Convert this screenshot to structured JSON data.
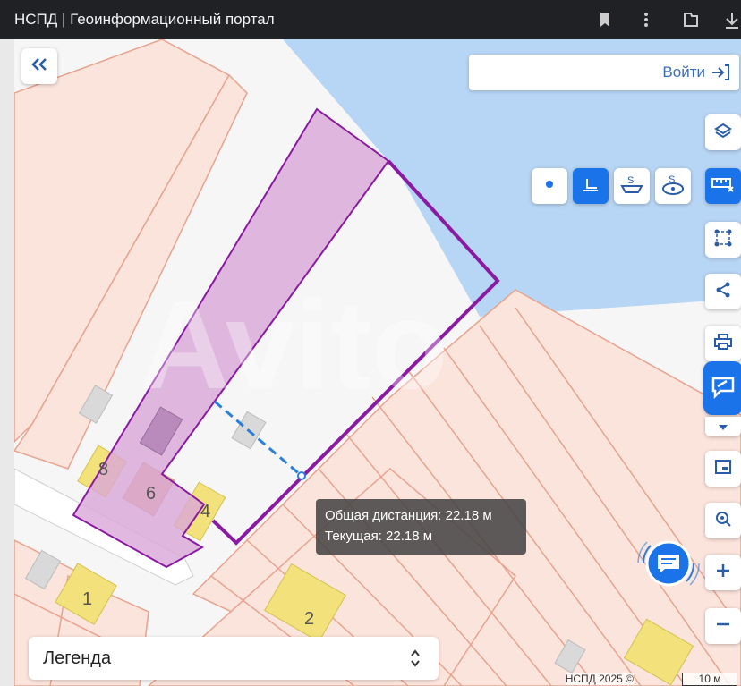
{
  "browser": {
    "tab_title": "НСПД | Геоинформационный портал",
    "icons": [
      "bookmark-icon",
      "more-vert-icon",
      "extensions-icon",
      "download-icon"
    ]
  },
  "header": {
    "collapse_icon": "double-chevron-left-icon",
    "login_label": "Войти",
    "login_icon": "login-icon"
  },
  "measure_tools": {
    "items": [
      "point-icon",
      "line-measure-icon",
      "area-measure-icon",
      "circle-measure-icon"
    ],
    "active": "line-measure-icon"
  },
  "right_toolbar": {
    "items": [
      "layers-icon",
      "ruler-close-icon",
      "select-area-icon",
      "share-icon",
      "print-icon",
      "chat-bubble-icon",
      "chevron-down-icon",
      "panel-icon",
      "geolocation-icon",
      "zoom-in-icon",
      "zoom-out-icon"
    ]
  },
  "map": {
    "parcel_labels": [
      "8",
      "6",
      "4",
      "1",
      "2"
    ],
    "watermark": "Avito"
  },
  "measurement": {
    "total": "Общая дистанция: 22.18 м",
    "current": "Текущая: 22.18 м"
  },
  "legend": {
    "label": "Легенда",
    "icon": "unfold-icon"
  },
  "footer": {
    "copyright": "НСПД 2025 ©",
    "scale": "10 м"
  },
  "colors": {
    "water": "#b7d5f4",
    "parcel_stroke": "#e8a38f",
    "parcel_fill": "#fbe4dc",
    "selected_fill": "#d9a6d8",
    "selected_stroke": "#8b1aa3",
    "building": "#f3e27b",
    "accent": "#1a73e8"
  }
}
